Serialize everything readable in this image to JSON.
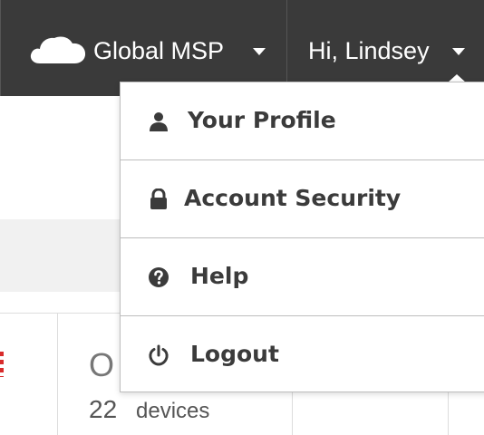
{
  "header": {
    "org_name": "Global MSP",
    "user_greeting": "Hi, Lindsey",
    "icons": {
      "logo": "cloud-icon",
      "org_caret": "caret-down-icon",
      "user_caret": "caret-down-icon"
    }
  },
  "user_menu": {
    "items": [
      {
        "label": "Your Profile",
        "icon": "user-icon"
      },
      {
        "label": "Account Security",
        "icon": "lock-icon"
      },
      {
        "label": "Help",
        "icon": "question-circle-icon"
      },
      {
        "label": "Logout",
        "icon": "power-icon"
      }
    ]
  },
  "background": {
    "stat_letter": "O",
    "stat_count": "22",
    "stat_unit": "devices"
  },
  "colors": {
    "topbar": "#3a3a3a",
    "menu_text": "#3b3b3b",
    "alert_red": "#d82b2b"
  }
}
